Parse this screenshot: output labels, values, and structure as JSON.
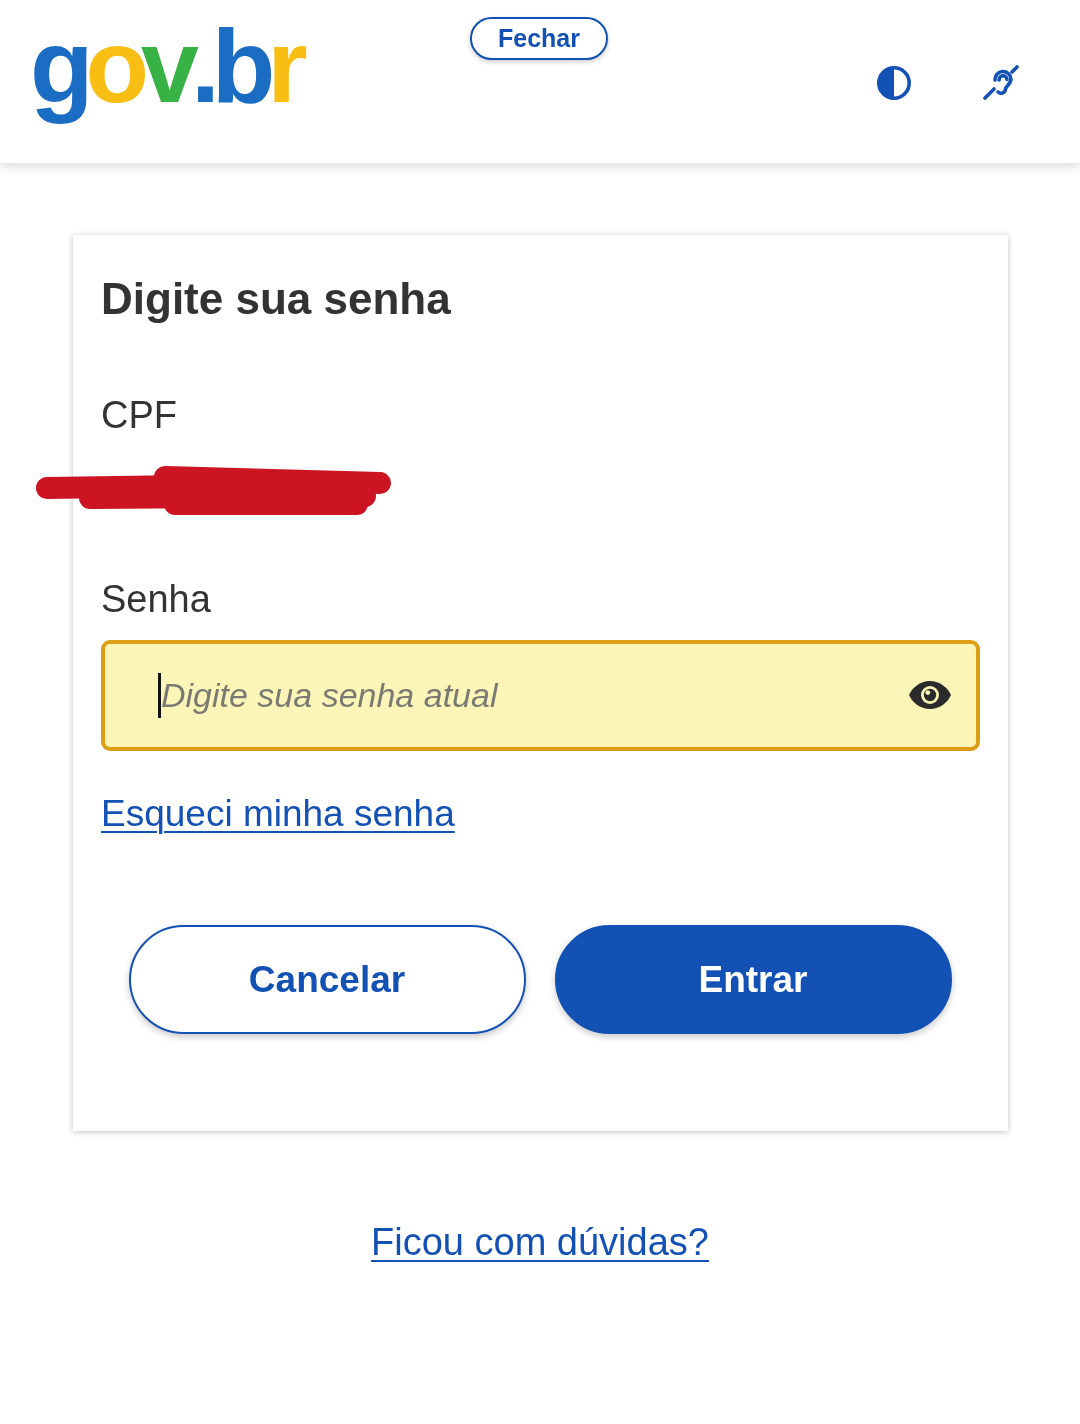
{
  "header": {
    "logo": "gov.br",
    "close_button": "Fechar"
  },
  "login_card": {
    "title": "Digite sua senha",
    "cpf": {
      "label": "CPF",
      "redacted": true
    },
    "password": {
      "label": "Senha",
      "placeholder": "Digite sua senha atual",
      "focused": true
    },
    "forgot_link": "Esqueci minha senha",
    "buttons": [
      {
        "label": "Cancelar",
        "kind": "secondary"
      },
      {
        "label": "Entrar",
        "kind": "primary"
      }
    ]
  },
  "help_link": "Ficou com dúvidas?"
}
